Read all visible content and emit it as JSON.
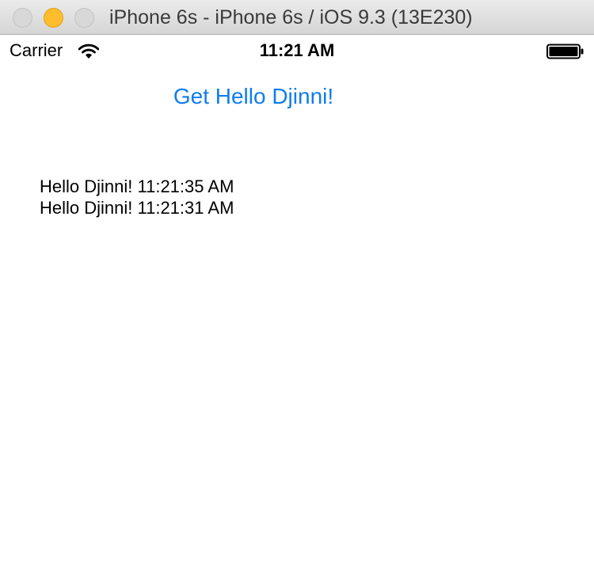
{
  "window": {
    "title": "iPhone 6s - iPhone 6s / iOS 9.3 (13E230)",
    "controls": [
      "close",
      "minimize",
      "zoom"
    ]
  },
  "status_bar": {
    "carrier": "Carrier",
    "wifi_icon": "wifi-icon",
    "time": "11:21 AM",
    "battery_icon": "battery-icon"
  },
  "main": {
    "button_label": "Get Hello Djinni!",
    "log": [
      "Hello Djinni! 11:21:35 AM",
      "Hello Djinni! 11:21:31 AM"
    ]
  },
  "colors": {
    "accent": "#0f7cf0",
    "minimize": "#ffbd2e"
  }
}
